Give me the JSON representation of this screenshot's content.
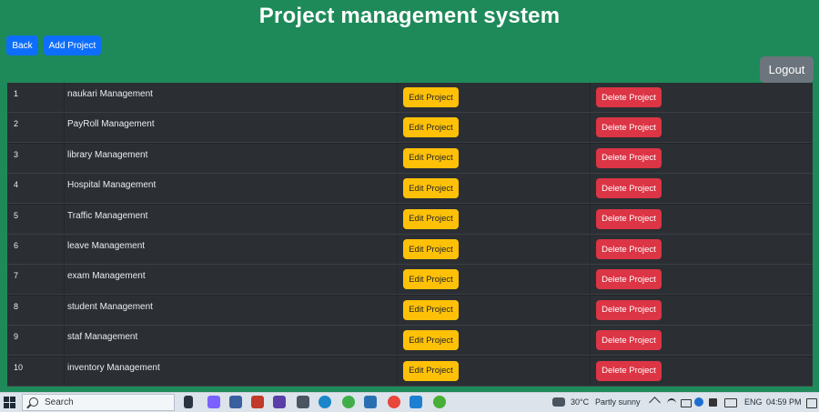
{
  "header": {
    "title": "Project management system"
  },
  "toolbar": {
    "back_label": "Back",
    "add_label": "Add Project",
    "logout_label": "Logout"
  },
  "table": {
    "edit_label": "Edit Project",
    "delete_label": "Delete Project",
    "rows": [
      {
        "num": "1",
        "name": "naukari Management"
      },
      {
        "num": "2",
        "name": "PayRoll Management"
      },
      {
        "num": "3",
        "name": "library Management"
      },
      {
        "num": "4",
        "name": "Hospital Management"
      },
      {
        "num": "5",
        "name": "Traffic Management"
      },
      {
        "num": "6",
        "name": "leave Management"
      },
      {
        "num": "7",
        "name": "exam Management"
      },
      {
        "num": "8",
        "name": "student Management"
      },
      {
        "num": "9",
        "name": "staf Management"
      },
      {
        "num": "10",
        "name": "inventory Management"
      }
    ]
  },
  "taskbar": {
    "search_placeholder": "Search",
    "temperature": "30°C",
    "weather": "Partly sunny",
    "language": "ENG",
    "time": "04:59 PM",
    "icons": [
      "windows-icon",
      "search-icon",
      "task-view-icon",
      "copilot-icon",
      "app-icon",
      "app-icon",
      "app-icon",
      "camera-icon",
      "edge-icon",
      "app-icon",
      "app-icon",
      "chrome-icon",
      "vscode-icon",
      "app-icon"
    ]
  },
  "colors": {
    "background": "#1e8a5a",
    "primary": "#0d6efd",
    "warning": "#ffc107",
    "danger": "#dc3545",
    "secondary": "#6c757d",
    "table_dark": "#2b2f33"
  }
}
